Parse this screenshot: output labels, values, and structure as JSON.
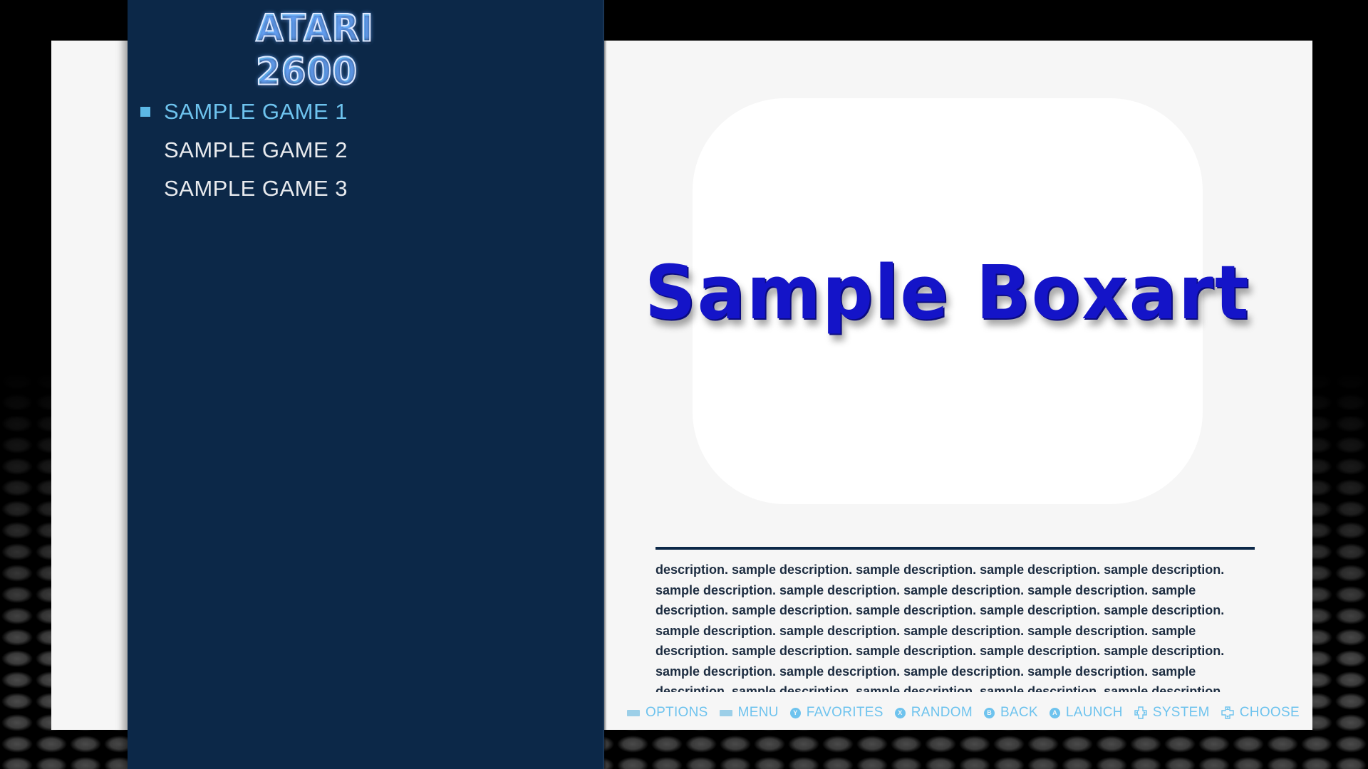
{
  "system": {
    "logo_text": "ATARI 2600"
  },
  "games": [
    {
      "label": "SAMPLE GAME 1",
      "selected": true
    },
    {
      "label": "SAMPLE GAME 2",
      "selected": false
    },
    {
      "label": "SAMPLE GAME 3",
      "selected": false
    }
  ],
  "boxart": {
    "text": "Sample Boxart"
  },
  "description": "description. sample description. sample description. sample description. sample description. sample description. sample description. sample description. sample description. sample description. sample description. sample description. sample description. sample description. sample description. sample description. sample description. sample description. sample description. sample description. sample description. sample description. sample description. sample description. sample description. sample description. sample description. sample description. sample description. sample description. sample description. sample description. sample description. sample description. sample description.",
  "help": [
    {
      "icon": "select-button-icon",
      "label": "OPTIONS"
    },
    {
      "icon": "start-button-icon",
      "label": "MENU"
    },
    {
      "icon": "y-button-icon",
      "glyph": "Y",
      "label": "FAVORITES"
    },
    {
      "icon": "x-button-icon",
      "glyph": "X",
      "label": "RANDOM"
    },
    {
      "icon": "b-button-icon",
      "glyph": "B",
      "label": "BACK"
    },
    {
      "icon": "a-button-icon",
      "glyph": "A",
      "label": "LAUNCH"
    },
    {
      "icon": "dpad-left-right-icon",
      "label": "SYSTEM"
    },
    {
      "icon": "dpad-up-down-icon",
      "label": "CHOOSE"
    }
  ],
  "colors": {
    "sidebar_bg": "#0c2848",
    "selected_text": "#6ec3ee",
    "help_text": "#6ec3ee",
    "boxart_text": "#1414c8"
  }
}
